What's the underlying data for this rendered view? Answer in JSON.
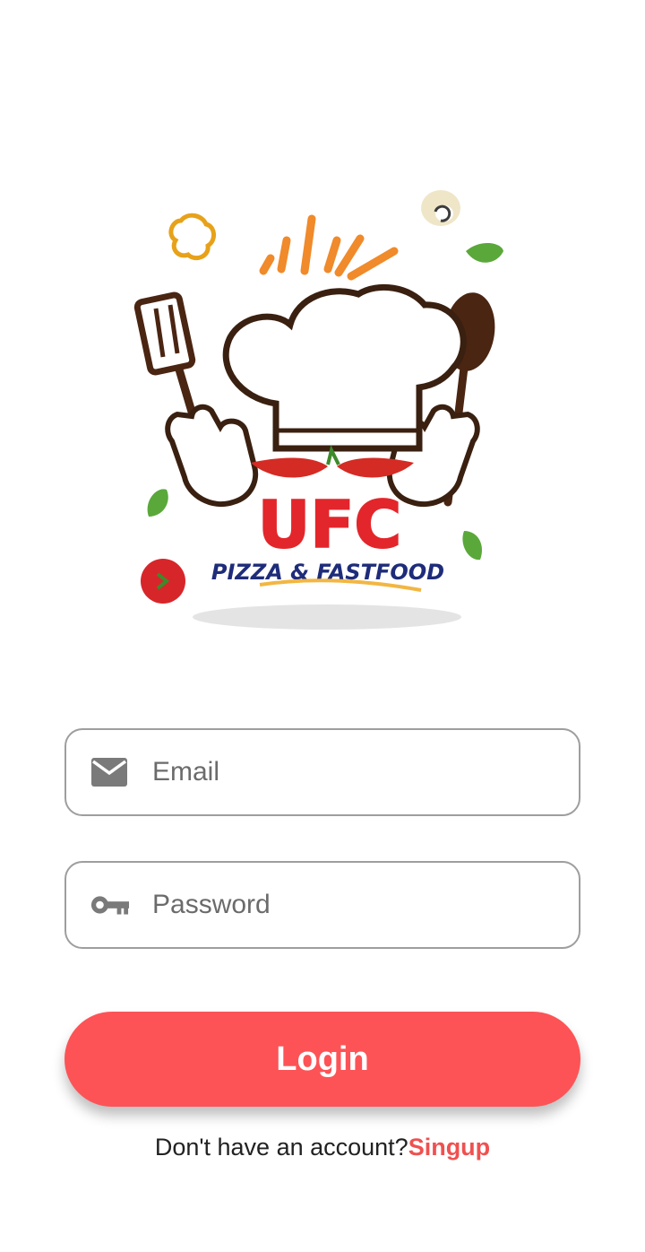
{
  "logo": {
    "brand": "UFC",
    "tagline": "PIZZA & FASTFOOD"
  },
  "form": {
    "email_placeholder": "Email",
    "password_placeholder": "Password",
    "email_icon": "mail-icon",
    "password_icon": "key-icon"
  },
  "actions": {
    "login_label": "Login",
    "no_account_text": "Don't have an account?",
    "signup_label": "Singup"
  },
  "colors": {
    "accent": "#fd5356",
    "link": "#f05050",
    "border": "#9e9e9e",
    "icon": "#7a7a7a"
  }
}
